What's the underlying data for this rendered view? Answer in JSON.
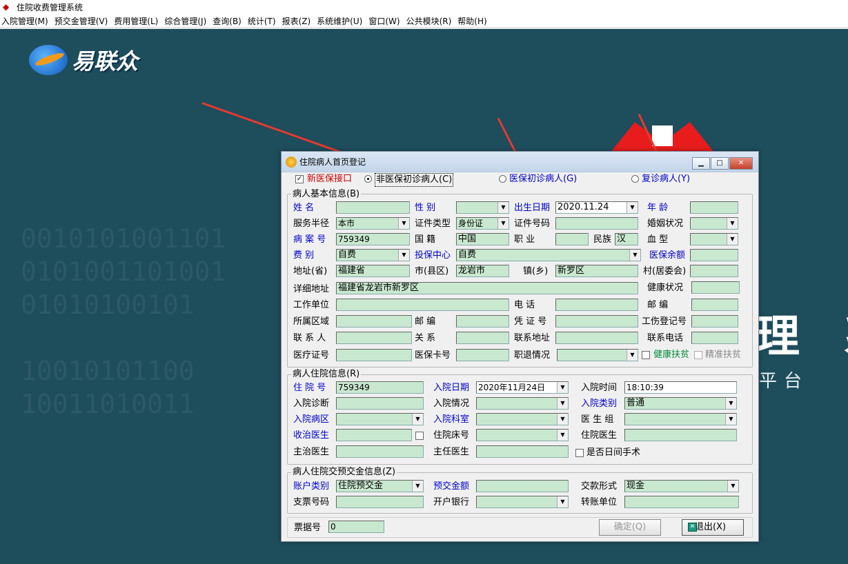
{
  "app": {
    "title": "住院收费管理系统"
  },
  "menu": [
    "入院管理(M)",
    "预交金管理(V)",
    "费用管理(L)",
    "综合管理(J)",
    "查询(B)",
    "统计(T)",
    "报表(Z)",
    "系统维护(U)",
    "窗口(W)",
    "公共模块(R)",
    "帮助(H)"
  ],
  "background": {
    "logo_text": "易联众",
    "big_text": "理 系",
    "sub_text": "平台",
    "digits": "0010101001101\n0101001101001\n01010100101\n\n10010101100\n10011010011"
  },
  "dialog": {
    "title": "住院病人首页登记",
    "top": {
      "xinyibao": "新医保接口",
      "radio1": "非医保初诊病人(C)",
      "radio2": "医保初诊病人(G)",
      "radio3": "复诊病人(Y)"
    },
    "basic": {
      "group": "病人基本信息(B)",
      "xingming": "姓    名",
      "xingbie": "性    别",
      "chusheng": "出生日期",
      "chusheng_val": "2020.11.24",
      "nianling": "年    龄",
      "fuwu": "服务半径",
      "fuwu_val": "本市",
      "zhengjianlx": "证件类型",
      "zhengjianlx_val": "身份证",
      "zhengjianhm": "证件号码",
      "hunyin": "婚姻状况",
      "bingan": "病 案 号",
      "bingan_val": "759349",
      "guoji": "国    籍",
      "guoji_val": "中国",
      "zhiye": "职    业",
      "minzu": "民族",
      "minzu_val": "汉",
      "xuexing": "血    型",
      "feibie": "费    别",
      "feibie_val": "自费",
      "toubao": "投保中心",
      "toubao_val": "自费",
      "yibaoye": "医保余额",
      "sheng": "地址(省)",
      "sheng_val": "福建省",
      "shi": "市(县区)",
      "shi_val": "龙岩市",
      "zhen": "镇(乡)",
      "zhen_val": "新罗区",
      "cun": "村(居委会)",
      "xiangxi": "详细地址",
      "xiangxi_val": "福建省龙岩市新罗区",
      "jiankang": "健康状况",
      "gongzuo": "工作单位",
      "dianhua": "电    话",
      "youbian": "邮    编",
      "suoshu": "所属区域",
      "youbian2": "邮    编",
      "pingzheng": "凭 证 号",
      "gongshang": "工伤登记号",
      "lianxiren": "联 系 人",
      "guanxi": "关    系",
      "lianxidizhi": "联系地址",
      "lianxidianhua": "联系电话",
      "yiliao": "医疗证号",
      "yibaoka": "医保卡号",
      "zhituiqk": "职退情况",
      "jkfp": "健康扶贫",
      "jzfp": "精准扶贫"
    },
    "inpatient": {
      "group": "病人住院信息(R)",
      "zhuyuanhao": "住 院 号",
      "zhuyuanhao_val": "759349",
      "ruyuanrq": "入院日期",
      "ruyuanrq_val": "2020年11月24日",
      "ruyuansj": "入院时间",
      "ruyuansj_val": "18:10:39",
      "zhenduan": "入院诊断",
      "qingkuang": "入院情况",
      "leibie": "入院类别",
      "leibie_val": "普通",
      "bingqu": "入院病区",
      "keshi": "入院科室",
      "yishengzu": "医 生 组",
      "shouzhi": "收治医生",
      "chuanghao": "住院床号",
      "zhuyuanys": "住院医生",
      "zhuzhi": "主治医生",
      "zhuren": "主任医生",
      "rijian": "是否日间手术"
    },
    "deposit": {
      "group": "病人住院交预交金信息(Z)",
      "zhanghu": "账户类别",
      "zhanghu_val": "住院预交金",
      "yujiao": "预交金额",
      "jiaokuan": "交款形式",
      "jiaokuan_val": "现金",
      "zhipiao": "支票号码",
      "kaihu": "开户银行",
      "zhuanzhang": "转账单位"
    },
    "bottom": {
      "piaoju": "票据号",
      "piaoju_val": "0",
      "confirm": "确定(Q)",
      "exit": "退出(X)"
    }
  }
}
